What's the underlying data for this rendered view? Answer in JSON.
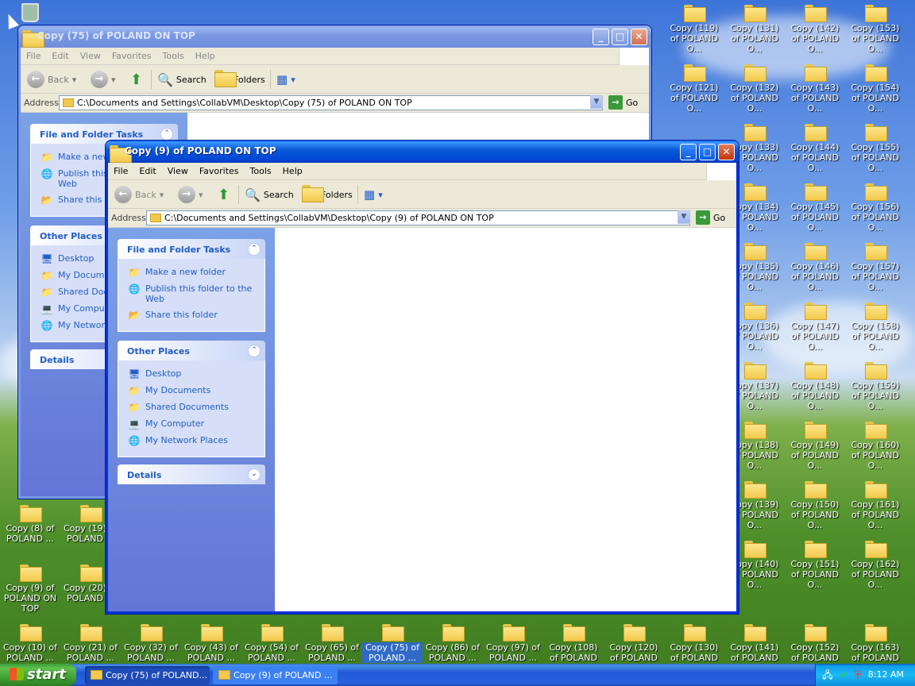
{
  "desktop": {
    "icons": [
      {
        "label": "Copy (8) of POLAND ...",
        "selected": false
      },
      {
        "label": "Copy (19) of POLAND ...",
        "selected": false
      },
      {
        "label": "Copy (9) of POLAND ON TOP",
        "selected": false
      },
      {
        "label": "Copy (20) of POLAND ...",
        "selected": false
      },
      {
        "label": "Copy (10) of POLAND ...",
        "selected": false
      },
      {
        "label": "Copy (21) of POLAND ...",
        "selected": false
      },
      {
        "label": "Copy (32) of POLAND ...",
        "selected": false
      },
      {
        "label": "Copy (43) of POLAND ...",
        "selected": false
      },
      {
        "label": "Copy (54) of POLAND ...",
        "selected": false
      },
      {
        "label": "Copy (65) of POLAND ...",
        "selected": false
      },
      {
        "label": "Copy (75) of POLAND ...",
        "selected": true
      },
      {
        "label": "Copy (86) of POLAND ...",
        "selected": false
      },
      {
        "label": "Copy (97) of POLAND ...",
        "selected": false
      },
      {
        "label": "Copy (108) of POLAND O...",
        "selected": false
      },
      {
        "label": "Copy (120) of POLAND O...",
        "selected": false
      },
      {
        "label": "Copy (130) of POLAND O...",
        "selected": false
      },
      {
        "label": "Copy (141) of POLAND O...",
        "selected": false
      },
      {
        "label": "Copy (152) of POLAND O...",
        "selected": false
      },
      {
        "label": "Copy (163) of POLAND O...",
        "selected": false
      },
      {
        "label": "Copy (119) of POLAND O...",
        "selected": false
      },
      {
        "label": "Copy (131) of POLAND O...",
        "selected": false
      },
      {
        "label": "Copy (142) of POLAND O...",
        "selected": false
      },
      {
        "label": "Copy (153) of POLAND O...",
        "selected": false
      },
      {
        "label": "Copy (121) of POLAND O...",
        "selected": false
      },
      {
        "label": "Copy (132) of POLAND O...",
        "selected": false
      },
      {
        "label": "Copy (143) of POLAND O...",
        "selected": false
      },
      {
        "label": "Copy (154) of POLAND O...",
        "selected": false
      },
      {
        "label": "Copy (133) of POLAND O...",
        "selected": false
      },
      {
        "label": "Copy (144) of POLAND O...",
        "selected": false
      },
      {
        "label": "Copy (155) of POLAND O...",
        "selected": false
      },
      {
        "label": "Copy (134) of POLAND O...",
        "selected": false
      },
      {
        "label": "Copy (145) of POLAND O...",
        "selected": false
      },
      {
        "label": "Copy (156) of POLAND O...",
        "selected": false
      },
      {
        "label": "Copy (135) of POLAND O...",
        "selected": false
      },
      {
        "label": "Copy (146) of POLAND O...",
        "selected": false
      },
      {
        "label": "Copy (157) of POLAND O...",
        "selected": false
      },
      {
        "label": "Copy (136) of POLAND O...",
        "selected": false
      },
      {
        "label": "Copy (147) of POLAND O...",
        "selected": false
      },
      {
        "label": "Copy (158) of POLAND O...",
        "selected": false
      },
      {
        "label": "Copy (137) of POLAND O...",
        "selected": false
      },
      {
        "label": "Copy (148) of POLAND O...",
        "selected": false
      },
      {
        "label": "Copy (159) of POLAND O...",
        "selected": false
      },
      {
        "label": "Copy (138) of POLAND O...",
        "selected": false
      },
      {
        "label": "Copy (149) of POLAND O...",
        "selected": false
      },
      {
        "label": "Copy (160) of POLAND O...",
        "selected": false
      },
      {
        "label": "Copy (139) of POLAND O...",
        "selected": false
      },
      {
        "label": "Copy (150) of POLAND O...",
        "selected": false
      },
      {
        "label": "Copy (161) of POLAND O...",
        "selected": false
      },
      {
        "label": "Copy (140) of POLAND O...",
        "selected": false
      },
      {
        "label": "Copy (151) of POLAND O...",
        "selected": false
      },
      {
        "label": "Copy (162) of POLAND O...",
        "selected": false
      }
    ]
  },
  "window_back": {
    "title": "Copy (75) of POLAND ON TOP",
    "menu": [
      "File",
      "Edit",
      "View",
      "Favorites",
      "Tools",
      "Help"
    ],
    "toolbar": {
      "back": "Back",
      "search": "Search",
      "folders": "Folders"
    },
    "address_label": "Address",
    "address": "C:\\Documents and Settings\\CollabVM\\Desktop\\Copy (75) of POLAND ON TOP",
    "go": "Go",
    "tasks_title": "File and Folder Tasks",
    "tasks": [
      "Make a new folder",
      "Publish this folder to the Web",
      "Share this folder"
    ],
    "places_title": "Other Places",
    "places": [
      "Desktop",
      "My Documents",
      "Shared Documents",
      "My Computer",
      "My Network Places"
    ],
    "details_title": "Details"
  },
  "window_front": {
    "title": "Copy (9) of POLAND ON TOP",
    "menu": [
      "File",
      "Edit",
      "View",
      "Favorites",
      "Tools",
      "Help"
    ],
    "toolbar": {
      "back": "Back",
      "search": "Search",
      "folders": "Folders"
    },
    "address_label": "Address",
    "address": "C:\\Documents and Settings\\CollabVM\\Desktop\\Copy (9) of POLAND ON TOP",
    "go": "Go",
    "tasks_title": "File and Folder Tasks",
    "tasks": [
      "Make a new folder",
      "Publish this folder to the Web",
      "Share this folder"
    ],
    "places_title": "Other Places",
    "places": [
      "Desktop",
      "My Documents",
      "Shared Documents",
      "My Computer",
      "My Network Places"
    ],
    "details_title": "Details"
  },
  "taskbar": {
    "start": "start",
    "tasks": [
      "Copy (75) of POLAND...",
      "Copy (9) of POLAND ..."
    ],
    "clock": "8:12 AM"
  },
  "colors": {
    "xp_blue": "#0a5ad8",
    "link_blue": "#215dc6",
    "selection": "#316ac5",
    "start_green": "#3c9a30"
  }
}
